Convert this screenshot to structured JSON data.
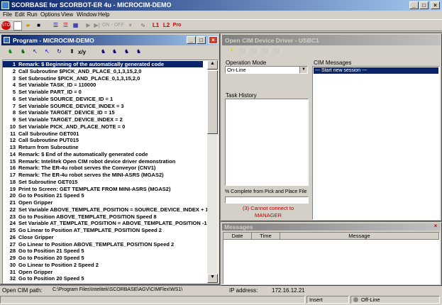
{
  "app": {
    "title": "SCORBASE for SCORBOT-ER 4u - MICROCIM-DEMO"
  },
  "menu": [
    "File",
    "Edit",
    "Run",
    "Options",
    "View",
    "Window",
    "Help"
  ],
  "toolbar": {
    "on_off_label": "ON - OFF"
  },
  "program": {
    "title": "Program - MICROCIM-DEMO",
    "toolbar_xy": "x/y",
    "lines": [
      {
        "n": "1",
        "text": "Remark: $ Beginning of the automatically generated code"
      },
      {
        "n": "2",
        "text": "Call Subroutine $PICK_AND_PLACE_0,1,3,15,2,0"
      },
      {
        "n": "3",
        "text": "Set Subroutine $PICK_AND_PLACE_0,1,3,15,2,0"
      },
      {
        "n": "4",
        "text": "Set Variable TASK_ID  = 110000"
      },
      {
        "n": "5",
        "text": "Set Variable PART_ID  = 0"
      },
      {
        "n": "6",
        "text": "Set Variable SOURCE_DEVICE_ID  = 1"
      },
      {
        "n": "7",
        "text": "Set Variable SOURCE_DEVICE_INDEX  = 3"
      },
      {
        "n": "8",
        "text": "Set Variable TARGET_DEVICE_ID  = 15"
      },
      {
        "n": "9",
        "text": "Set Variable TARGET_DEVICE_INDEX  = 2"
      },
      {
        "n": "10",
        "text": "Set Variable PICK_AND_PLACE_NOTE  = 0"
      },
      {
        "n": "11",
        "text": "Call Subroutine GET001"
      },
      {
        "n": "12",
        "text": "Call Subroutine PUT015"
      },
      {
        "n": "13",
        "text": "Return from Subroutine"
      },
      {
        "n": "14",
        "text": "Remark: $ End of the automatically generated code"
      },
      {
        "n": "15",
        "text": "Remark: Intelitek Open CIM robot device driver demonstration"
      },
      {
        "n": "16",
        "text": "Remark: The ER-4u robot serves the Conveyor (CNV1)"
      },
      {
        "n": "17",
        "text": "Remark: The ER-4u robot serves the MINI-ASRS (MGAS2)"
      },
      {
        "n": "18",
        "text": "Set Subroutine GET015"
      },
      {
        "n": "19",
        "text": "Print to Screen: GET TEMPLATE FROM MINI-ASRS (MGAS2)"
      },
      {
        "n": "20",
        "text": "Go to Position 21 Speed 5"
      },
      {
        "n": "21",
        "text": "Open Gripper"
      },
      {
        "n": "22",
        "text": "Set Variable ABOVE_TEMPLATE_POSITION  = SOURCE_DEVICE_INDEX + 11"
      },
      {
        "n": "23",
        "text": "Go to Position ABOVE_TEMPLATE_POSITION Speed 8"
      },
      {
        "n": "24",
        "text": "Set Variable AT_TEMPLATE_POSITION  = ABOVE_TEMPLATE_POSITION -10"
      },
      {
        "n": "25",
        "text": "Go Linear to Position AT_TEMPLATE_POSITION Speed 2"
      },
      {
        "n": "26",
        "text": "Close Gripper"
      },
      {
        "n": "27",
        "text": "Go Linear to Position ABOVE_TEMPLATE_POSITION Speed 2"
      },
      {
        "n": "28",
        "text": "Go to Position 21 Speed 5"
      },
      {
        "n": "29",
        "text": "Go to Position 20 Speed 5"
      },
      {
        "n": "30",
        "text": "Go Linear to Position 2 Speed 2"
      },
      {
        "n": "31",
        "text": "Open Gripper"
      },
      {
        "n": "32",
        "text": "Go to Position 20 Speed 5"
      }
    ]
  },
  "cim": {
    "title": "Open CIM Device Driver - USBC1",
    "operation_mode_label": "Operation Mode",
    "operation_mode_value": "On-Line",
    "task_history_label": "Task History",
    "complete_label": "% Complete from Pick and Place File",
    "error_text_1": "(3) Cannot connect to",
    "error_text_2": "MANAGER",
    "messages_label": "CIM Messages",
    "messages": [
      "--- Start new session ---"
    ]
  },
  "messages": {
    "title": "Messages",
    "columns": [
      "Date",
      "Time",
      "Message"
    ]
  },
  "status": {
    "path_label": "Open CIM path:",
    "path_value": "C:\\Program Files\\Intelitek\\SCORBASE\\AGV\\CIMFlex\\WS1\\",
    "ip_label": "IP address:",
    "ip_value": "172.16.12.21",
    "insert": "Insert",
    "offline": "Off-Line"
  },
  "colors": {
    "title_active": "#0a246a",
    "error_red": "#c00000"
  }
}
